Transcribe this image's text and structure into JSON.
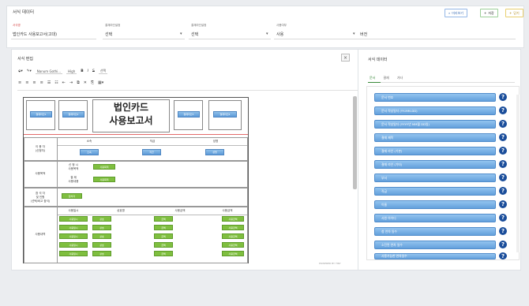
{
  "header": {
    "title": "서식 데이터",
    "buttons": {
      "preview": "미리보기",
      "save": "저장",
      "close": "닫기"
    },
    "fields": [
      {
        "label": "서식명",
        "value": "법인카드 사용보고서(고대)",
        "required": true
      },
      {
        "label": "결재라인설정",
        "value": "선택"
      },
      {
        "label": "결재라인설정",
        "value": "선택"
      },
      {
        "label": "사용여부",
        "value": "사용"
      },
      {
        "label": "",
        "value": "버전"
      }
    ]
  },
  "editor": {
    "title": "서식 편집",
    "close": "×",
    "toolbar": {
      "font": "Nanum Gothi...",
      "size": "High",
      "bold": "B",
      "italic": "I",
      "strike": "S",
      "select": "선택"
    },
    "status": "POWERED BY TINY"
  },
  "document": {
    "title": "법인카드\n사용보고서",
    "header_fields": [
      "결재라인1",
      "결재라인2",
      "결재라인3",
      "결재라인4"
    ],
    "sections": {
      "user_info": {
        "label": "이 용 자\n(신청자)",
        "cols": [
          "소속",
          "직급",
          "성명"
        ],
        "vals": [
          "소속",
          "직급",
          "성명"
        ]
      },
      "purpose": {
        "label": "사용목적",
        "rows": [
          "신 청 시\n사용목적",
          "결 제\n사용내용"
        ],
        "val": "사용목적"
      },
      "reference": {
        "label": "참 석 자\n및 인원\n(선택/비고 참석)",
        "val": "참석자"
      },
      "history": {
        "label": "사용내역",
        "cols": [
          "사용일시",
          "상호명",
          "사용금액",
          "사용금액"
        ],
        "rows": [
          [
            "사용일시",
            "상호",
            "금액",
            "사용금액"
          ],
          [
            "사용일시",
            "상호",
            "금액",
            "사용금액"
          ],
          [
            "사용일시",
            "상호",
            "금액",
            "사용금액"
          ],
          [
            "사용일시",
            "상호",
            "금액",
            "사용금액"
          ],
          [
            "사용일시",
            "상호",
            "금액",
            "사용금액"
          ]
        ]
      }
    }
  },
  "right_panel": {
    "title": "서식 데이터",
    "tabs": [
      "문서",
      "결재",
      "기타"
    ],
    "active_tab": 0,
    "items": [
      "문서 번호",
      "문서 작성일자 (YY-MM-DD)",
      "문서 작성일자 (YYYY년 MM월 DD일)",
      "결재 제목",
      "결재 라인 (기본)",
      "결재 라인 (기타)",
      "부서",
      "직급",
      "이름",
      "사원 아이디",
      "첨 연차 일수",
      "소진된 연차 일수",
      "사용가능한 연차일수"
    ]
  }
}
